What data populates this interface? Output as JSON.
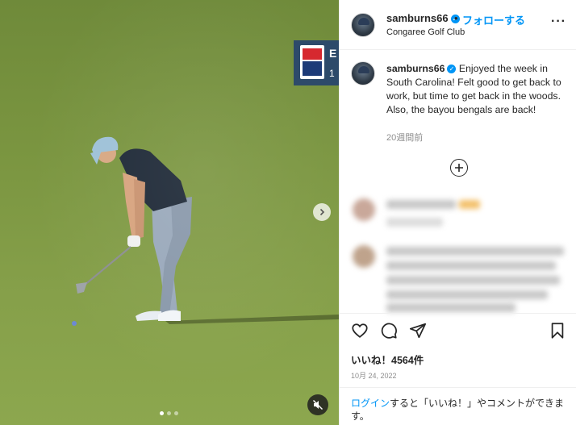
{
  "media": {
    "tour_badge_text": "E",
    "tour_badge_sub": "1",
    "slides_total": 3,
    "slide_active": 1
  },
  "header": {
    "username": "samburns66",
    "separator": "•",
    "follow_label": "フォローする",
    "location": "Congaree Golf Club",
    "more_label": "···"
  },
  "caption": {
    "username": "samburns66",
    "text": "Enjoyed the week in South Carolina! Felt good to get back to work, but time to get back in the woods. Also, the bayou bengals are back!",
    "time_ago": "20週間前"
  },
  "engagement": {
    "likes": "いいね！4564件",
    "date": "10月 24, 2022"
  },
  "login": {
    "link": "ログイン",
    "rest": "すると「いいね！」やコメントができます。"
  },
  "icons": {
    "verified": "verified-badge-icon",
    "like": "heart-icon",
    "comment": "comment-icon",
    "share": "send-icon",
    "save": "bookmark-icon",
    "next": "chevron-right-icon",
    "mute": "speaker-muted-icon",
    "add_comment": "plus-circle-icon"
  },
  "colors": {
    "accent": "#0095f6",
    "text": "#262626",
    "muted": "#8e8e8e"
  }
}
